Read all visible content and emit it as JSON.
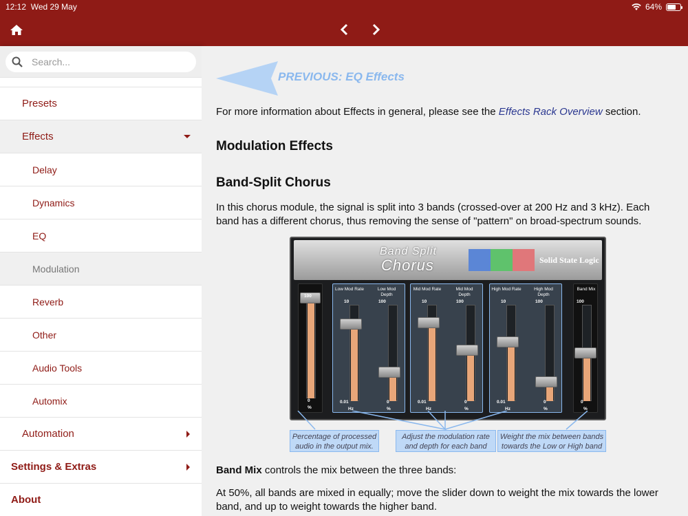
{
  "status": {
    "time": "12:12",
    "date": "Wed 29 May",
    "battery": "64%",
    "battery_level": 0.64
  },
  "search": {
    "placeholder": "Search..."
  },
  "sidebar": {
    "items": [
      {
        "label": "Presets"
      },
      {
        "label": "Effects"
      },
      {
        "label": "Delay"
      },
      {
        "label": "Dynamics"
      },
      {
        "label": "EQ"
      },
      {
        "label": "Modulation"
      },
      {
        "label": "Reverb"
      },
      {
        "label": "Other"
      },
      {
        "label": "Audio Tools"
      },
      {
        "label": "Automix"
      },
      {
        "label": "Automation"
      },
      {
        "label": "Settings & Extras"
      },
      {
        "label": "About"
      }
    ]
  },
  "content": {
    "prev_label": "PREVIOUS: EQ Effects",
    "intro_before": "For more information about Effects in general, please see the ",
    "intro_link": "Effects Rack Overview",
    "intro_after": " section.",
    "h_modulation": "Modulation Effects",
    "h_chorus": "Band-Split Chorus",
    "chorus_desc": "In this chorus module, the signal is split into 3 bands (crossed-over at 200 Hz and 3 kHz). Each band has a different chorus, thus removing the sense of \"pattern\" on broad-spectrum sounds.",
    "bandmix_bold": "Band Mix",
    "bandmix_text": " controls the mix between the three bands:",
    "bandmix_desc": "At 50%, all bands are mixed in equally; move the slider down to weight the mix towards the lower band, and up to weight towards the higher band."
  },
  "plugin": {
    "title_line1": "Band Split",
    "title_line2": "Chorus",
    "brand": "Solid State Logic",
    "band_colors": [
      "#5b86d6",
      "#5fc26c",
      "#e0777a"
    ],
    "fader_labels": [
      "Low Mod Rate",
      "Low Mod Depth",
      "Mid Mod Rate",
      "Mid Mod Depth",
      "High Mod Rate",
      "High Mod Depth",
      "Band Mix"
    ],
    "top_values": [
      "100",
      "10",
      "100",
      "10",
      "100",
      "10",
      "100",
      "100"
    ],
    "bottom_values": [
      "0",
      "0.01",
      "0",
      "0.01",
      "0",
      "0.01",
      "0",
      "0"
    ],
    "units": [
      "%",
      "Hz",
      "%",
      "Hz",
      "%",
      "Hz",
      "%",
      "%"
    ],
    "callouts": [
      "Percentage of processed audio in the output mix.",
      "Adjust the modulation rate and depth for each band",
      "Weight the mix between bands towards the Low or High band"
    ]
  }
}
